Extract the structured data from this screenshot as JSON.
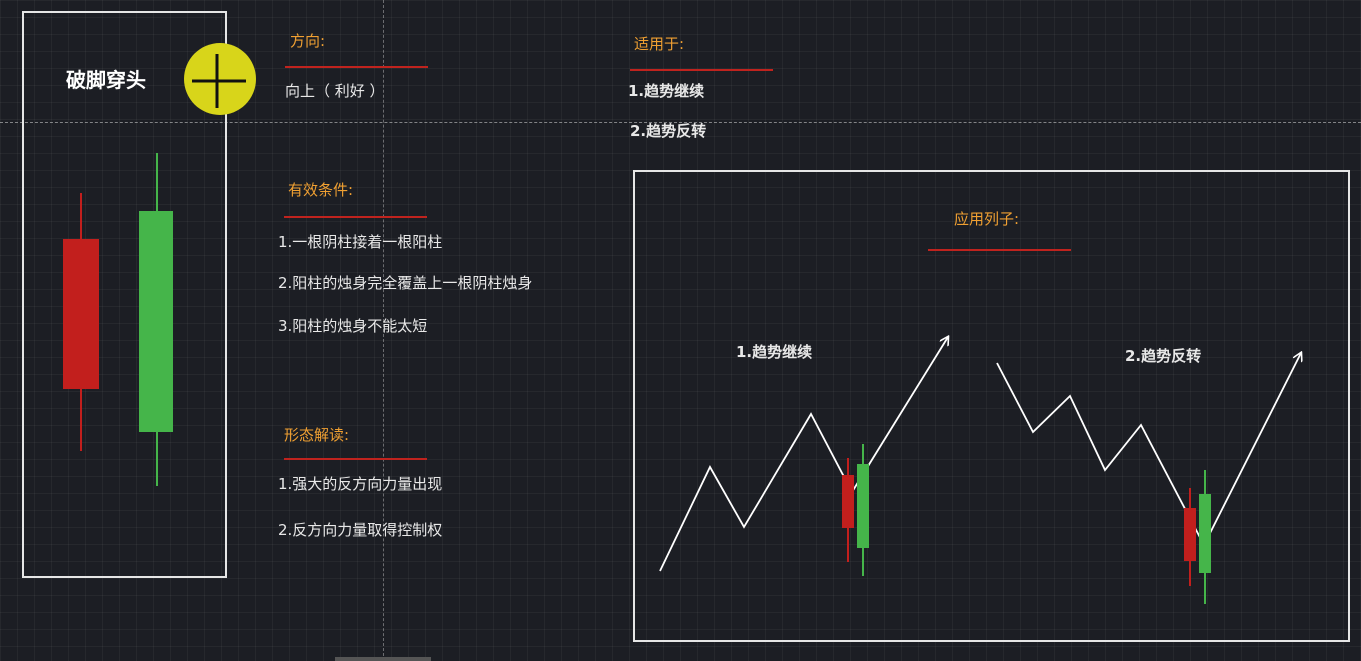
{
  "pattern": {
    "title": "破脚穿头",
    "bear_candle_color": "#c21f1d",
    "bull_candle_color": "#45b54a"
  },
  "cursor_icon": "crosshair-icon",
  "direction": {
    "label": "方向:",
    "value": "向上（ 利好 ）"
  },
  "applicable": {
    "label": "适用于:",
    "items": [
      "1.趋势继续",
      "2.趋势反转"
    ]
  },
  "conditions": {
    "label": "有效条件:",
    "items": [
      "1.一根阴柱接着一根阳柱",
      "2.阳柱的烛身完全覆盖上一根阴柱烛身",
      "3.阳柱的烛身不能太短"
    ]
  },
  "interpretation": {
    "label": "形态解读:",
    "items": [
      "1.强大的反方向力量出现",
      "2.反方向力量取得控制权"
    ]
  },
  "example": {
    "title": "应用列子:",
    "cases": [
      "1.趋势继续",
      "2.趋势反转"
    ]
  },
  "colors": {
    "accent_orange": "#f0a032",
    "underline_red": "#c0231e"
  }
}
